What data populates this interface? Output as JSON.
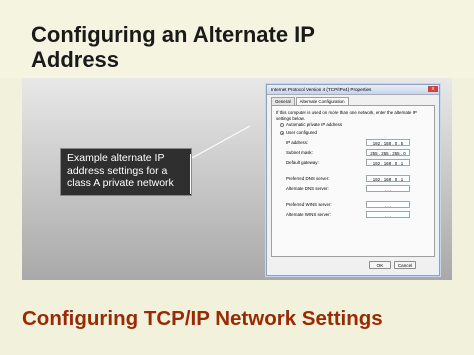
{
  "slide": {
    "title": "Configuring an Alternate IP Address",
    "callout": "Example alternate IP address settings for a class A private network",
    "footer_title": "Configuring TCP/IP Network Settings"
  },
  "dialog": {
    "title": "Internet Protocol Version 4 (TCP/IPv4) Properties",
    "close_label": "X",
    "tabs": [
      "General",
      "Alternate Configuration"
    ],
    "intro": "If this computer is used on more than one network, enter the alternate IP settings below.",
    "radio_automatic": "Automatic private IP address",
    "radio_user": "User configured",
    "fields": {
      "ip_label": "IP address:",
      "ip_value": "192 . 168 . 0 . 5",
      "subnet_label": "Subnet mask:",
      "subnet_value": "255 . 255 . 255 . 0",
      "gateway_label": "Default gateway:",
      "gateway_value": "192 . 168 . 0 . 1",
      "pref_dns_label": "Preferred DNS server:",
      "pref_dns_value": "192 . 168 . 0 . 1",
      "alt_dns_label": "Alternate DNS server:",
      "alt_dns_value": ". . .",
      "pref_wins_label": "Preferred WINS server:",
      "pref_wins_value": ". . .",
      "alt_wins_label": "Alternate WINS server:",
      "alt_wins_value": ". . ."
    },
    "ok_label": "OK",
    "cancel_label": "Cancel"
  }
}
